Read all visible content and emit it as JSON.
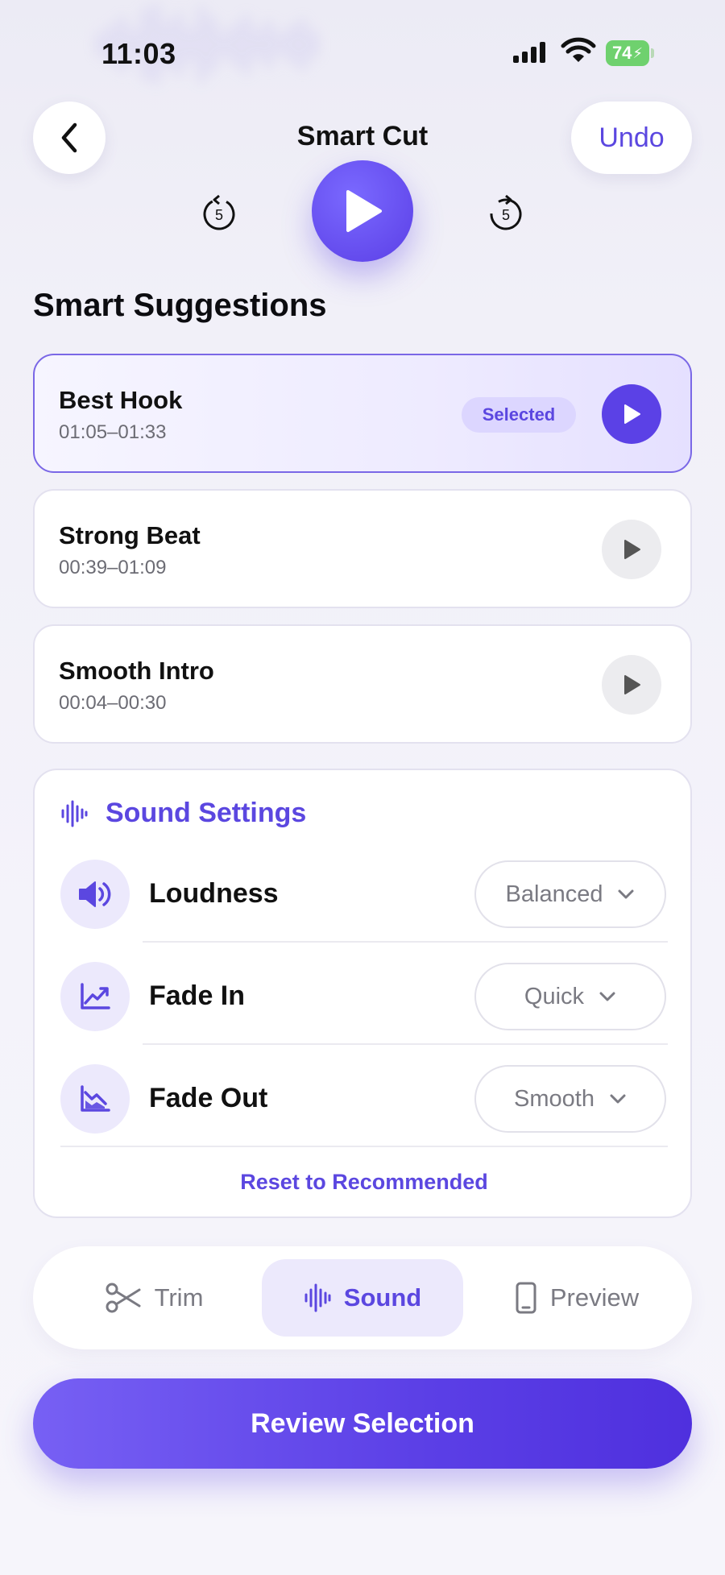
{
  "status_bar": {
    "time": "11:03",
    "battery": "74"
  },
  "header": {
    "title": "Smart Cut",
    "undo_label": "Undo",
    "skip_back_label": "5",
    "skip_forward_label": "5"
  },
  "suggestions": {
    "title": "Smart Suggestions",
    "items": [
      {
        "title": "Best Hook",
        "range": "01:05–01:33",
        "badge": "Selected",
        "selected": true
      },
      {
        "title": "Strong Beat",
        "range": "00:39–01:09",
        "selected": false
      },
      {
        "title": "Smooth Intro",
        "range": "00:04–00:30",
        "selected": false
      }
    ]
  },
  "sound_settings": {
    "title": "Sound Settings",
    "rows": [
      {
        "label": "Loudness",
        "value": "Balanced",
        "icon": "speaker-icon"
      },
      {
        "label": "Fade In",
        "value": "Quick",
        "icon": "fade-in-chart-icon"
      },
      {
        "label": "Fade Out",
        "value": "Smooth",
        "icon": "fade-out-chart-icon"
      }
    ],
    "reset_label": "Reset to Recommended"
  },
  "tabs": [
    {
      "label": "Trim",
      "icon": "scissors-icon",
      "active": false
    },
    {
      "label": "Sound",
      "icon": "waveform-icon",
      "active": true
    },
    {
      "label": "Preview",
      "icon": "phone-icon",
      "active": false
    }
  ],
  "primary_button": {
    "label": "Review Selection"
  },
  "colors": {
    "accent": "#5b47e0",
    "accent_dark": "#4f30de",
    "selected_badge_bg": "#dcd6ff",
    "battery_green": "#6fd16e"
  }
}
